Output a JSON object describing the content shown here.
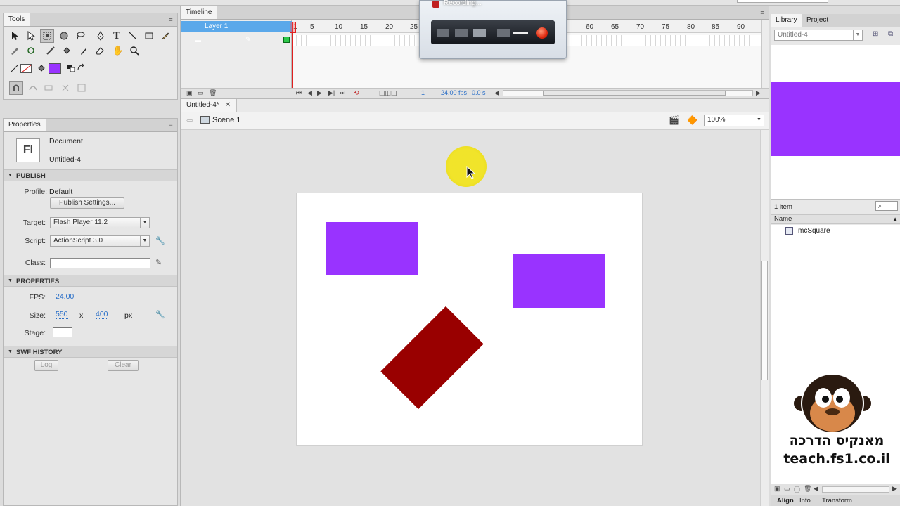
{
  "colors": {
    "purple": "#9933ff",
    "dark_red": "#990000",
    "layer_highlight": "#5aa8ea",
    "link_blue": "#2a6fc8",
    "cursor_highlight": "#f2e41a"
  },
  "recorder": {
    "title": "Recording..."
  },
  "tools": {
    "tab": "Tools",
    "icons": [
      "selection-icon",
      "subselection-icon",
      "free-transform-icon",
      "3d-rotation-icon",
      "lasso-icon",
      "pen-icon",
      "text-icon",
      "line-icon",
      "rectangle-icon",
      "pencil-icon",
      "brush-icon",
      "deco-icon",
      "bone-icon",
      "paint-bucket-icon",
      "eyedropper-icon",
      "eraser-icon",
      "hand-icon",
      "zoom-icon",
      "stroke-color-icon",
      "fill-color-icon",
      "swap-colors-icon",
      "snap-icon",
      "smooth-icon",
      "straighten-icon",
      "rotate-icon",
      "scale-icon"
    ]
  },
  "timeline": {
    "tab": "Timeline",
    "layer": "Layer 1",
    "ruler": [
      "1",
      "5",
      "10",
      "15",
      "20",
      "25",
      "60",
      "65",
      "70",
      "75",
      "80",
      "85",
      "90"
    ],
    "fps": "24.00 fps",
    "time": "0.0 s",
    "frame": "1"
  },
  "document": {
    "tab": "Untitled-4*",
    "scene": "Scene 1",
    "zoom": "100%"
  },
  "properties": {
    "tab": "Properties",
    "doc_type": "Document",
    "doc_name": "Untitled-4",
    "doc_icon": "Fl",
    "publish": {
      "heading": "PUBLISH",
      "profile_label": "Profile:",
      "profile_value": "Default",
      "publish_settings": "Publish Settings...",
      "target_label": "Target:",
      "target_value": "Flash Player 11.2",
      "script_label": "Script:",
      "script_value": "ActionScript 3.0",
      "class_label": "Class:"
    },
    "props": {
      "heading": "PROPERTIES",
      "fps_label": "FPS:",
      "fps_value": "24.00",
      "size_label": "Size:",
      "width": "550",
      "x": "x",
      "height": "400",
      "unit": "px",
      "stage_label": "Stage:"
    },
    "swf": {
      "heading": "SWF HISTORY",
      "log": "Log",
      "clear": "Clear"
    }
  },
  "library": {
    "tab_library": "Library",
    "tab_project": "Project",
    "doc_select": "Untitled-4",
    "count": "1 item",
    "name_header": "Name",
    "items": [
      "mcSquare"
    ],
    "bottom_tabs": [
      "Align",
      "Info",
      "Transform"
    ]
  },
  "watermark": {
    "line1": "מאנקיס הדרכה",
    "line2": "teach.fs1.co.il"
  }
}
